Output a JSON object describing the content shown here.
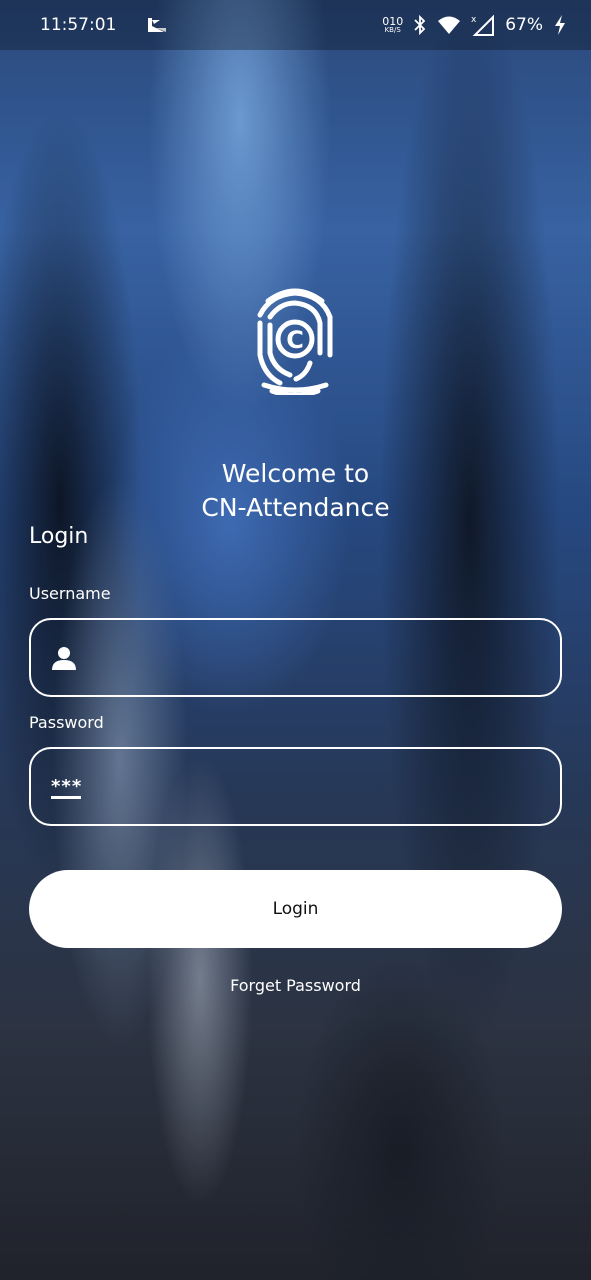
{
  "status_bar": {
    "time": "11:57:01",
    "net_speed_value": "010",
    "net_speed_unit": "KB/S",
    "battery": "67%",
    "icons": [
      "notification-app-icon",
      "bluetooth-icon",
      "wifi-icon",
      "signal-icon",
      "charging-icon"
    ]
  },
  "welcome": {
    "line1": "Welcome to",
    "line2": "CN-Attendance"
  },
  "login": {
    "title": "Login",
    "username_label": "Username",
    "username_value": "",
    "password_label": "Password",
    "password_icon": "***",
    "password_value": "",
    "button_label": "Login",
    "forget_label": "Forget Password"
  },
  "colors": {
    "text": "#ffffff",
    "button_bg": "#ffffff",
    "button_text": "#111111"
  }
}
